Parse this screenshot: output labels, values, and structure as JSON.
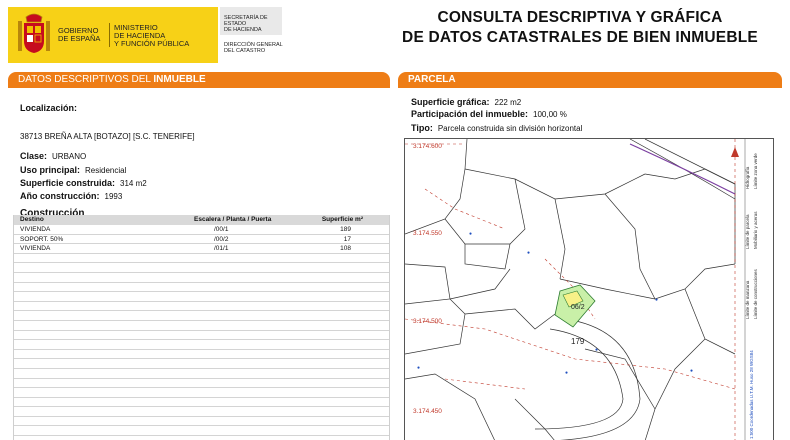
{
  "header": {
    "gov_line1": "GOBIERNO",
    "gov_line2": "DE ESPAÑA",
    "ministry_line1": "MINISTERIO",
    "ministry_line2": "DE HACIENDA",
    "ministry_line3": "Y FUNCIÓN PÚBLICA",
    "secretaria_line1": "SECRETARÍA DE ESTADO",
    "secretaria_line2": "DE HACIENDA",
    "direccion_line1": "DIRECCIÓN GENERAL",
    "direccion_line2": "DEL CATASTRO",
    "title_line1": "CONSULTA DESCRIPTIVA Y GRÁFICA",
    "title_line2": "DE DATOS CATASTRALES DE BIEN INMUEBLE"
  },
  "datos": {
    "section_title": "DATOS DESCRIPTIVOS DEL ",
    "section_title_bold": "INMUEBLE",
    "localizacion_label": "Localización:",
    "localizacion_value": "38713 BREÑA ALTA [BOTAZO] [S.C. TENERIFE]",
    "clase_label": "Clase:",
    "clase_value": "URBANO",
    "uso_label": "Uso principal:",
    "uso_value": "Residencial",
    "superficie_label": "Superficie construida:",
    "superficie_value": "314 m2",
    "anio_label": "Año construcción:",
    "anio_value": "1993",
    "construccion_label": "Construcción",
    "table_headers": {
      "destino": "Destino",
      "escalera": "Escalera / Planta / Puerta",
      "superficie": "Superficie m²"
    },
    "table_rows": [
      {
        "destino": "VIVIENDA",
        "escalera": "/00/1",
        "superficie": "189"
      },
      {
        "destino": "SOPORT. 50%",
        "escalera": "/00/2",
        "superficie": "17"
      },
      {
        "destino": "VIVIENDA",
        "escalera": "/01/1",
        "superficie": "108"
      }
    ]
  },
  "parcela": {
    "section_title": "PARCELA",
    "superficie_label": "Superficie gráfica:",
    "superficie_value": "222 m2",
    "participacion_label": "Participación del inmueble:",
    "participacion_value": "100,00 %",
    "tipo_label": "Tipo:",
    "tipo_value": "Parcela construida sin división horizontal"
  },
  "map": {
    "coord_1": "3.174.600",
    "coord_2": "3.174.550",
    "coord_3": "3.174.500",
    "coord_4": "3.174.450",
    "parcel_label": "179",
    "building_label": "06/2",
    "legend_1": "Hidrografía",
    "legend_2": "Límite zona verde",
    "legend_3": "Límite de parcela",
    "legend_4": "Mobiliario y aceras",
    "legend_5": "Límite de manzana",
    "legend_6": "Límite de construcciones",
    "legend_7": "1:500 Coordenadas U.T.M. Huso 28 WGS84"
  }
}
